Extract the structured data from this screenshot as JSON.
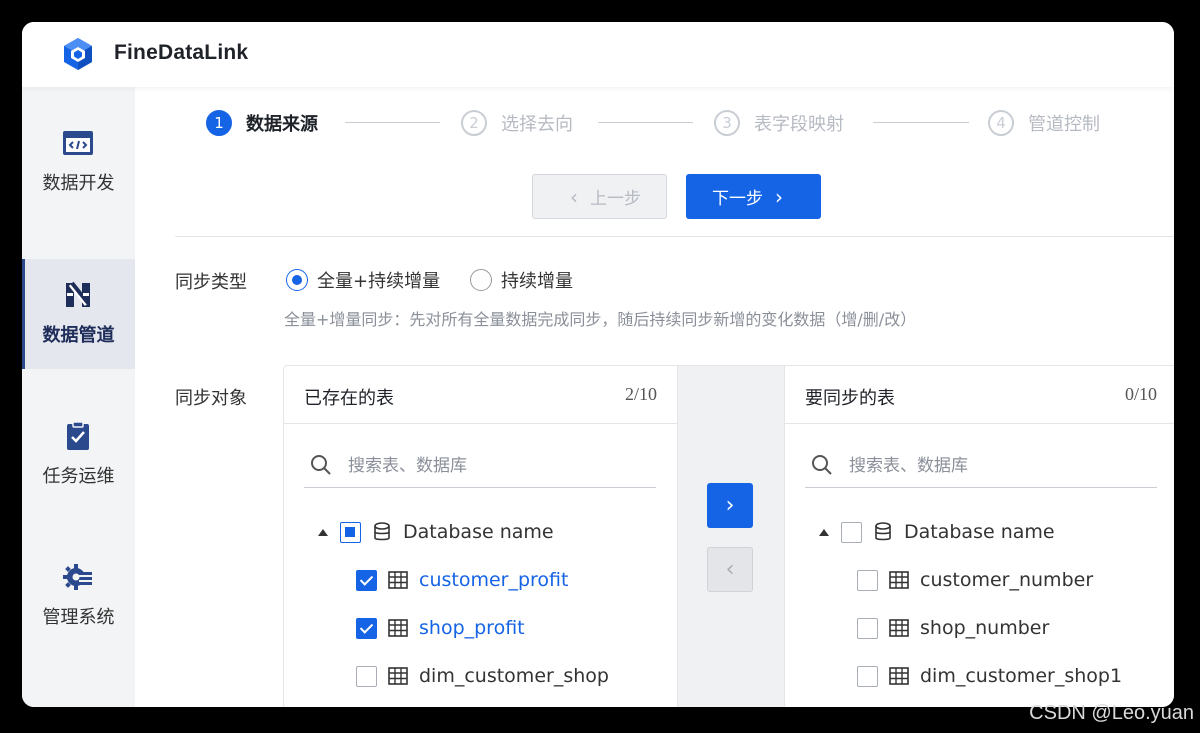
{
  "app": {
    "title": "FineDataLink"
  },
  "sidebar": {
    "items": [
      {
        "label": "数据开发",
        "icon": "code-window-icon",
        "active": false
      },
      {
        "label": "数据管道",
        "icon": "pipeline-icon",
        "active": true
      },
      {
        "label": "任务运维",
        "icon": "clipboard-check-icon",
        "active": false
      },
      {
        "label": "管理系统",
        "icon": "settings-gear-icon",
        "active": false
      }
    ]
  },
  "steps": [
    {
      "num": "1",
      "label": "数据来源",
      "active": true
    },
    {
      "num": "2",
      "label": "选择去向",
      "active": false
    },
    {
      "num": "3",
      "label": "表字段映射",
      "active": false
    },
    {
      "num": "4",
      "label": "管道控制",
      "active": false
    }
  ],
  "nav": {
    "prev_label": "上一步",
    "next_label": "下一步"
  },
  "sync_type": {
    "label": "同步类型",
    "options": [
      {
        "label": "全量+持续增量",
        "selected": true
      },
      {
        "label": "持续增量",
        "selected": false
      }
    ],
    "hint": "全量+增量同步：先对所有全量数据完成同步，随后持续同步新增的变化数据（增/删/改）"
  },
  "sync_object": {
    "label": "同步对象",
    "left": {
      "title": "已存在的表",
      "count": "2/10",
      "search_placeholder": "搜索表、数据库",
      "database": {
        "name": "Database name",
        "state": "partial"
      },
      "tables": [
        {
          "name": "customer_profit",
          "checked": true
        },
        {
          "name": "shop_profit",
          "checked": true
        },
        {
          "name": "dim_customer_shop",
          "checked": false
        }
      ]
    },
    "right": {
      "title": "要同步的表",
      "count": "0/10",
      "search_placeholder": "搜索表、数据库",
      "database": {
        "name": "Database name",
        "state": "unchecked"
      },
      "tables": [
        {
          "name": "customer_number",
          "checked": false
        },
        {
          "name": "shop_number",
          "checked": false
        },
        {
          "name": "dim_customer_shop1",
          "checked": false
        }
      ]
    }
  },
  "watermark": "CSDN @Leo.yuan",
  "colors": {
    "accent": "#1664e6",
    "sidebar_active_bar": "#2a4a8d",
    "disabled": "#b6bac2"
  }
}
